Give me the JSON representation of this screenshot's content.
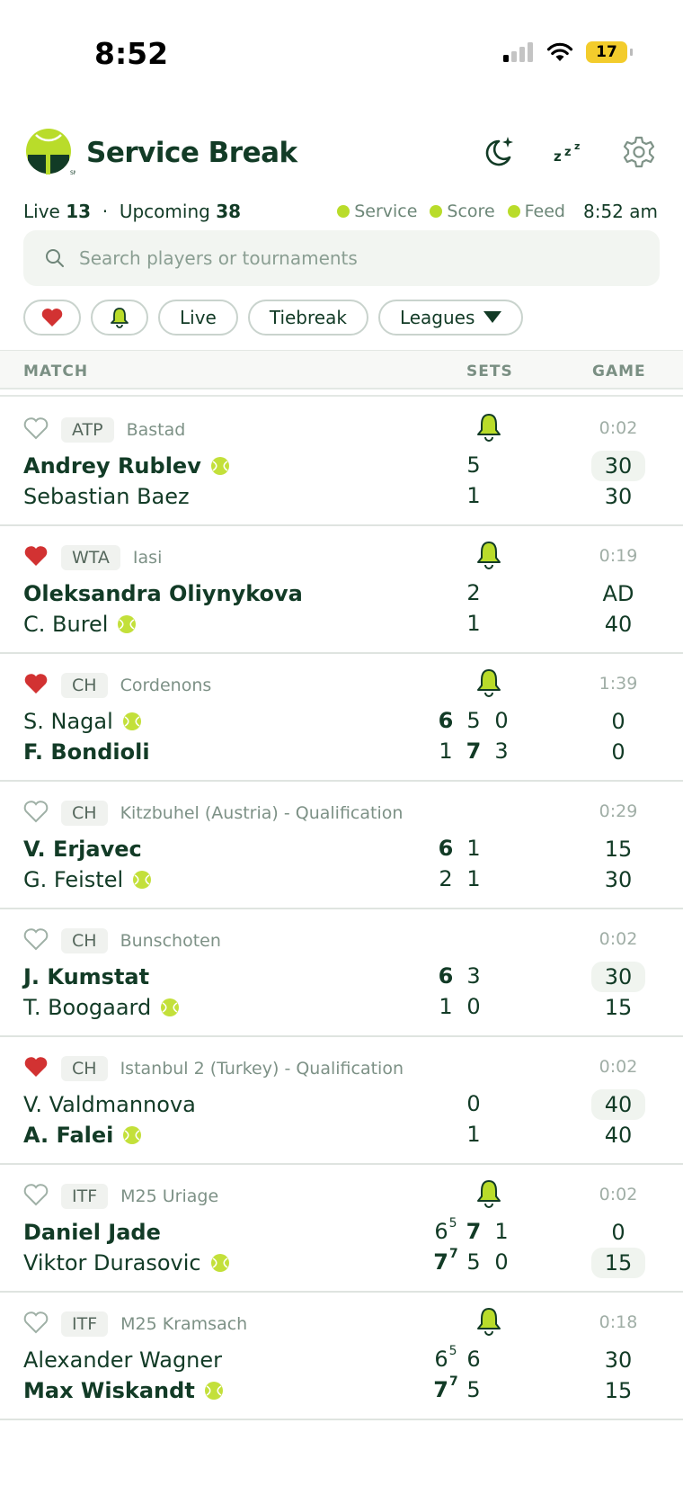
{
  "status_bar": {
    "time": "8:52",
    "battery": "17"
  },
  "app": {
    "title": "Service Break",
    "logo_mark": "SM"
  },
  "summary": {
    "live_label": "Live",
    "live_count": "13",
    "separator": "·",
    "upcoming_label": "Upcoming",
    "upcoming_count": "38",
    "legend": [
      "Service",
      "Score",
      "Feed"
    ],
    "clock": "8:52 am"
  },
  "search": {
    "placeholder": "Search players or tournaments"
  },
  "filters": {
    "live": "Live",
    "tiebreak": "Tiebreak",
    "leagues": "Leagues"
  },
  "columns": {
    "match": "MATCH",
    "sets": "SETS",
    "game": "GAME"
  },
  "colors": {
    "brand": "#123b26",
    "accent": "#b9dc2a",
    "favorite": "#d23232"
  },
  "matches": [
    {
      "fav": false,
      "tour": "ATP",
      "event": "Bastad",
      "bell": true,
      "elapsed": "0:02",
      "p1": {
        "name": "Andrey Rublev",
        "serving": true,
        "bold": true,
        "sets": [
          {
            "v": "5"
          }
        ],
        "game": "30",
        "game_hl": true
      },
      "p2": {
        "name": "Sebastian Baez",
        "serving": false,
        "bold": false,
        "sets": [
          {
            "v": "1"
          }
        ],
        "game": "30",
        "game_hl": false
      }
    },
    {
      "fav": true,
      "tour": "WTA",
      "event": "Iasi",
      "bell": true,
      "elapsed": "0:19",
      "p1": {
        "name": "Oleksandra Oliynykova",
        "serving": false,
        "bold": true,
        "sets": [
          {
            "v": "2"
          }
        ],
        "game": "AD",
        "game_hl": false
      },
      "p2": {
        "name": "C. Burel",
        "serving": true,
        "bold": false,
        "sets": [
          {
            "v": "1"
          }
        ],
        "game": "40",
        "game_hl": false
      }
    },
    {
      "fav": true,
      "tour": "CH",
      "event": "Cordenons",
      "bell": true,
      "elapsed": "1:39",
      "p1": {
        "name": "S. Nagal",
        "serving": true,
        "bold": false,
        "sets": [
          {
            "v": "6",
            "win": true
          },
          {
            "v": "5"
          },
          {
            "v": "0"
          }
        ],
        "game": "0",
        "game_hl": false
      },
      "p2": {
        "name": "F. Bondioli",
        "serving": false,
        "bold": true,
        "sets": [
          {
            "v": "1"
          },
          {
            "v": "7",
            "win": true
          },
          {
            "v": "3"
          }
        ],
        "game": "0",
        "game_hl": false
      }
    },
    {
      "fav": false,
      "tour": "CH",
      "event": "Kitzbuhel (Austria) - Qualification",
      "bell": false,
      "elapsed": "0:29",
      "p1": {
        "name": "V. Erjavec",
        "serving": false,
        "bold": true,
        "sets": [
          {
            "v": "6",
            "win": true
          },
          {
            "v": "1"
          }
        ],
        "game": "15",
        "game_hl": false
      },
      "p2": {
        "name": "G. Feistel",
        "serving": true,
        "bold": false,
        "sets": [
          {
            "v": "2"
          },
          {
            "v": "1"
          }
        ],
        "game": "30",
        "game_hl": false
      }
    },
    {
      "fav": false,
      "tour": "CH",
      "event": "Bunschoten",
      "bell": false,
      "elapsed": "0:02",
      "p1": {
        "name": "J. Kumstat",
        "serving": false,
        "bold": true,
        "sets": [
          {
            "v": "6",
            "win": true
          },
          {
            "v": "3"
          }
        ],
        "game": "30",
        "game_hl": true
      },
      "p2": {
        "name": "T. Boogaard",
        "serving": true,
        "bold": false,
        "sets": [
          {
            "v": "1"
          },
          {
            "v": "0"
          }
        ],
        "game": "15",
        "game_hl": false
      }
    },
    {
      "fav": true,
      "tour": "CH",
      "event": "Istanbul 2 (Turkey) - Qualification",
      "bell": false,
      "elapsed": "0:02",
      "p1": {
        "name": "V. Valdmannova",
        "serving": false,
        "bold": false,
        "sets": [
          {
            "v": "0"
          }
        ],
        "game": "40",
        "game_hl": true
      },
      "p2": {
        "name": "A. Falei",
        "serving": true,
        "bold": true,
        "sets": [
          {
            "v": "1"
          }
        ],
        "game": "40",
        "game_hl": false
      }
    },
    {
      "fav": false,
      "tour": "ITF",
      "event": "M25 Uriage",
      "bell": true,
      "elapsed": "0:02",
      "p1": {
        "name": "Daniel Jade",
        "serving": false,
        "bold": true,
        "sets": [
          {
            "v": "6",
            "tb": "5"
          },
          {
            "v": "7",
            "win": true
          },
          {
            "v": "1"
          }
        ],
        "game": "0",
        "game_hl": false
      },
      "p2": {
        "name": "Viktor Durasovic",
        "serving": true,
        "bold": false,
        "sets": [
          {
            "v": "7",
            "tb": "7",
            "win": true
          },
          {
            "v": "5"
          },
          {
            "v": "0"
          }
        ],
        "game": "15",
        "game_hl": true
      }
    },
    {
      "fav": false,
      "tour": "ITF",
      "event": "M25 Kramsach",
      "bell": true,
      "elapsed": "0:18",
      "p1": {
        "name": "Alexander Wagner",
        "serving": false,
        "bold": false,
        "sets": [
          {
            "v": "6",
            "tb": "5"
          },
          {
            "v": "6"
          }
        ],
        "game": "30",
        "game_hl": false
      },
      "p2": {
        "name": "Max Wiskandt",
        "serving": true,
        "bold": true,
        "sets": [
          {
            "v": "7",
            "tb": "7",
            "win": true
          },
          {
            "v": "5"
          }
        ],
        "game": "15",
        "game_hl": false
      }
    }
  ]
}
